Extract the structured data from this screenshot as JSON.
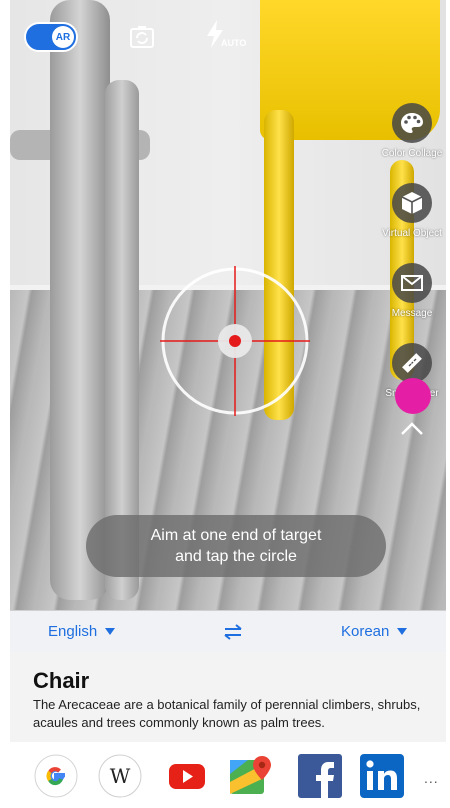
{
  "toolbar": {
    "ar_label": "AR",
    "flash_label": "AUTO",
    "icons": [
      "ar-toggle",
      "rotate-camera-icon",
      "flash-icon"
    ]
  },
  "tools": [
    {
      "label": "Color Collage",
      "icon": "palette-icon"
    },
    {
      "label": "Virtual Object",
      "icon": "cube-icon"
    },
    {
      "label": "Message",
      "icon": "envelope-icon"
    },
    {
      "label": "Smart Ruler",
      "icon": "ruler-icon"
    }
  ],
  "hint": {
    "line1": "Aim at one end of target",
    "line2": "and tap the circle"
  },
  "languages": {
    "source": "English",
    "target": "Korean"
  },
  "result": {
    "title": "Chair",
    "description": "The Arecaceae are a botanical family of perennial climbers, shrubs, acaules and trees commonly known as palm trees."
  },
  "engines": [
    "google-icon",
    "wikipedia-icon",
    "youtube-icon",
    "google-maps-icon",
    "facebook-icon",
    "linkedin-icon"
  ],
  "more_label": "..."
}
